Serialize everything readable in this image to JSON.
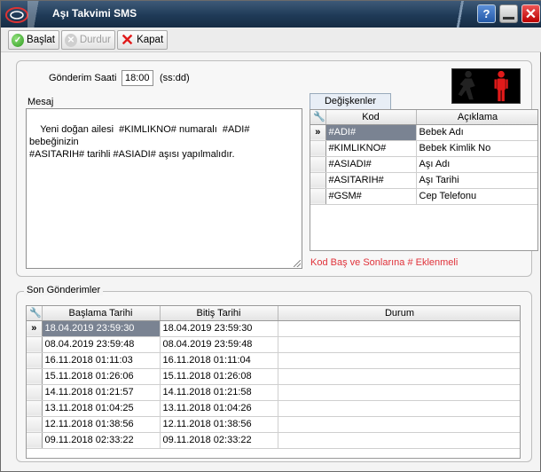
{
  "window": {
    "title": "Aşı Takvimi SMS",
    "help_glyph": "?",
    "close_glyph": "✕",
    "icons": [
      "app-logo-icon",
      "help-icon",
      "minimize-icon",
      "close-icon"
    ]
  },
  "toolbar": {
    "start_label": "Başlat",
    "stop_label": "Durdur",
    "close_label": "Kapat"
  },
  "settings": {
    "send_time_label": "Gönderim Saati",
    "send_time_value": "18:00",
    "send_time_format": "(ss:dd)",
    "message_label": "Mesaj",
    "message_text": "Yeni doğan ailesi  #KIMLIKNO# numaralı  #ADI# bebeğinizin\n#ASITARIH# tarihli #ASIADI# aşısı yapılmalıdır."
  },
  "variables": {
    "tab_label": "Değişkenler",
    "columns": [
      "Kod",
      "Açıklama"
    ],
    "rows": [
      {
        "kod": "#ADI#",
        "aciklama": "Bebek Adı",
        "selected": true
      },
      {
        "kod": "#KIMLIKNO#",
        "aciklama": "Bebek Kimlik No",
        "selected": false
      },
      {
        "kod": "#ASIADI#",
        "aciklama": "Aşı Adı",
        "selected": false
      },
      {
        "kod": "#ASITARIH#",
        "aciklama": "Aşı Tarihi",
        "selected": false
      },
      {
        "kod": "#GSM#",
        "aciklama": "Cep Telefonu",
        "selected": false
      }
    ],
    "note": "Kod Baş ve Sonlarına # Eklenmeli"
  },
  "history": {
    "title": "Son Gönderimler",
    "columns": [
      "Başlama Tarihi",
      "Bitiş Tarihi",
      "Durum"
    ],
    "rows": [
      {
        "start": "18.04.2019 23:59:30",
        "end": "18.04.2019 23:59:30",
        "status": "",
        "selected": true
      },
      {
        "start": "08.04.2019 23:59:48",
        "end": "08.04.2019 23:59:48",
        "status": "",
        "selected": false
      },
      {
        "start": "16.11.2018 01:11:03",
        "end": "16.11.2018 01:11:04",
        "status": "",
        "selected": false
      },
      {
        "start": "15.11.2018 01:26:06",
        "end": "15.11.2018 01:26:08",
        "status": "",
        "selected": false
      },
      {
        "start": "14.11.2018 01:21:57",
        "end": "14.11.2018 01:21:58",
        "status": "",
        "selected": false
      },
      {
        "start": "13.11.2018 01:04:25",
        "end": "13.11.2018 01:04:26",
        "status": "",
        "selected": false
      },
      {
        "start": "12.11.2018 01:38:56",
        "end": "12.11.2018 01:38:56",
        "status": "",
        "selected": false
      },
      {
        "start": "09.11.2018 02:33:22",
        "end": "09.11.2018 02:33:22",
        "status": "",
        "selected": false
      }
    ]
  },
  "colors": {
    "titlebar": "#1f3a57",
    "selected_row": "#7a8392",
    "note_red": "#e0323a",
    "status_red": "#e01a1a"
  }
}
